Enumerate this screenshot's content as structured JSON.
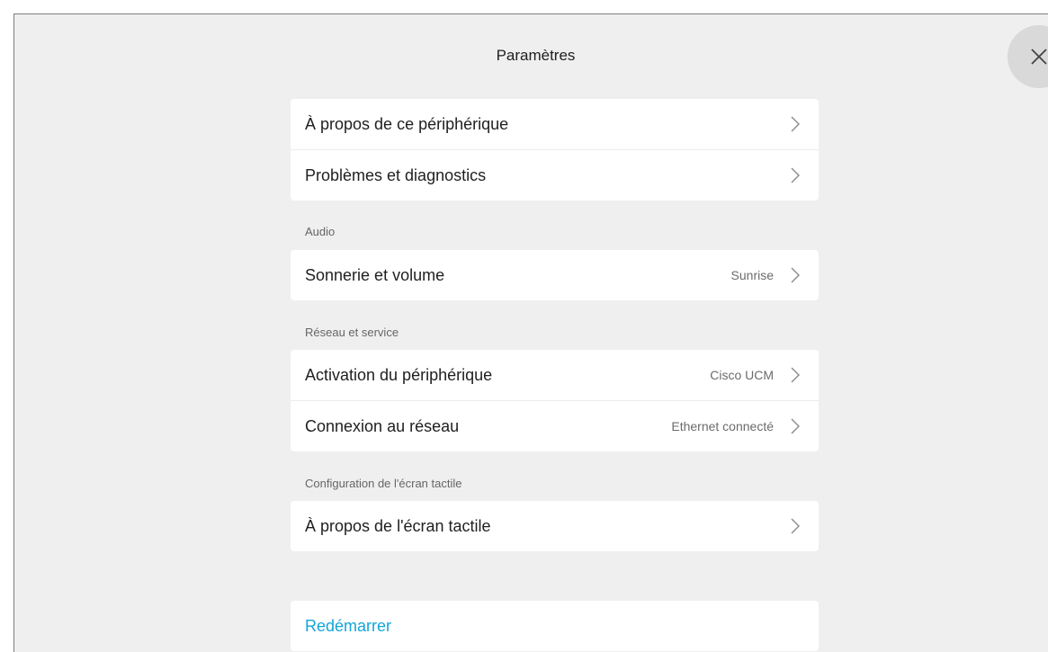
{
  "header": {
    "title": "Paramètres"
  },
  "close_icon": "close-icon",
  "group_general": {
    "items": [
      {
        "label": "À propos de ce périphérique",
        "value": ""
      },
      {
        "label": "Problèmes et diagnostics",
        "value": ""
      }
    ]
  },
  "section_audio": {
    "label": "Audio",
    "items": [
      {
        "label": "Sonnerie et volume",
        "value": "Sunrise"
      }
    ]
  },
  "section_network": {
    "label": "Réseau et service",
    "items": [
      {
        "label": "Activation du périphérique",
        "value": "Cisco UCM"
      },
      {
        "label": "Connexion au réseau",
        "value": "Ethernet connecté"
      }
    ]
  },
  "section_touch": {
    "label": "Configuration de l'écran tactile",
    "items": [
      {
        "label": "À propos de l'écran tactile",
        "value": ""
      }
    ]
  },
  "restart": {
    "label": "Redémarrer",
    "color": "#14a5d9"
  },
  "colors": {
    "background": "#efefef",
    "card": "#ffffff",
    "accent": "#14a5d9"
  }
}
